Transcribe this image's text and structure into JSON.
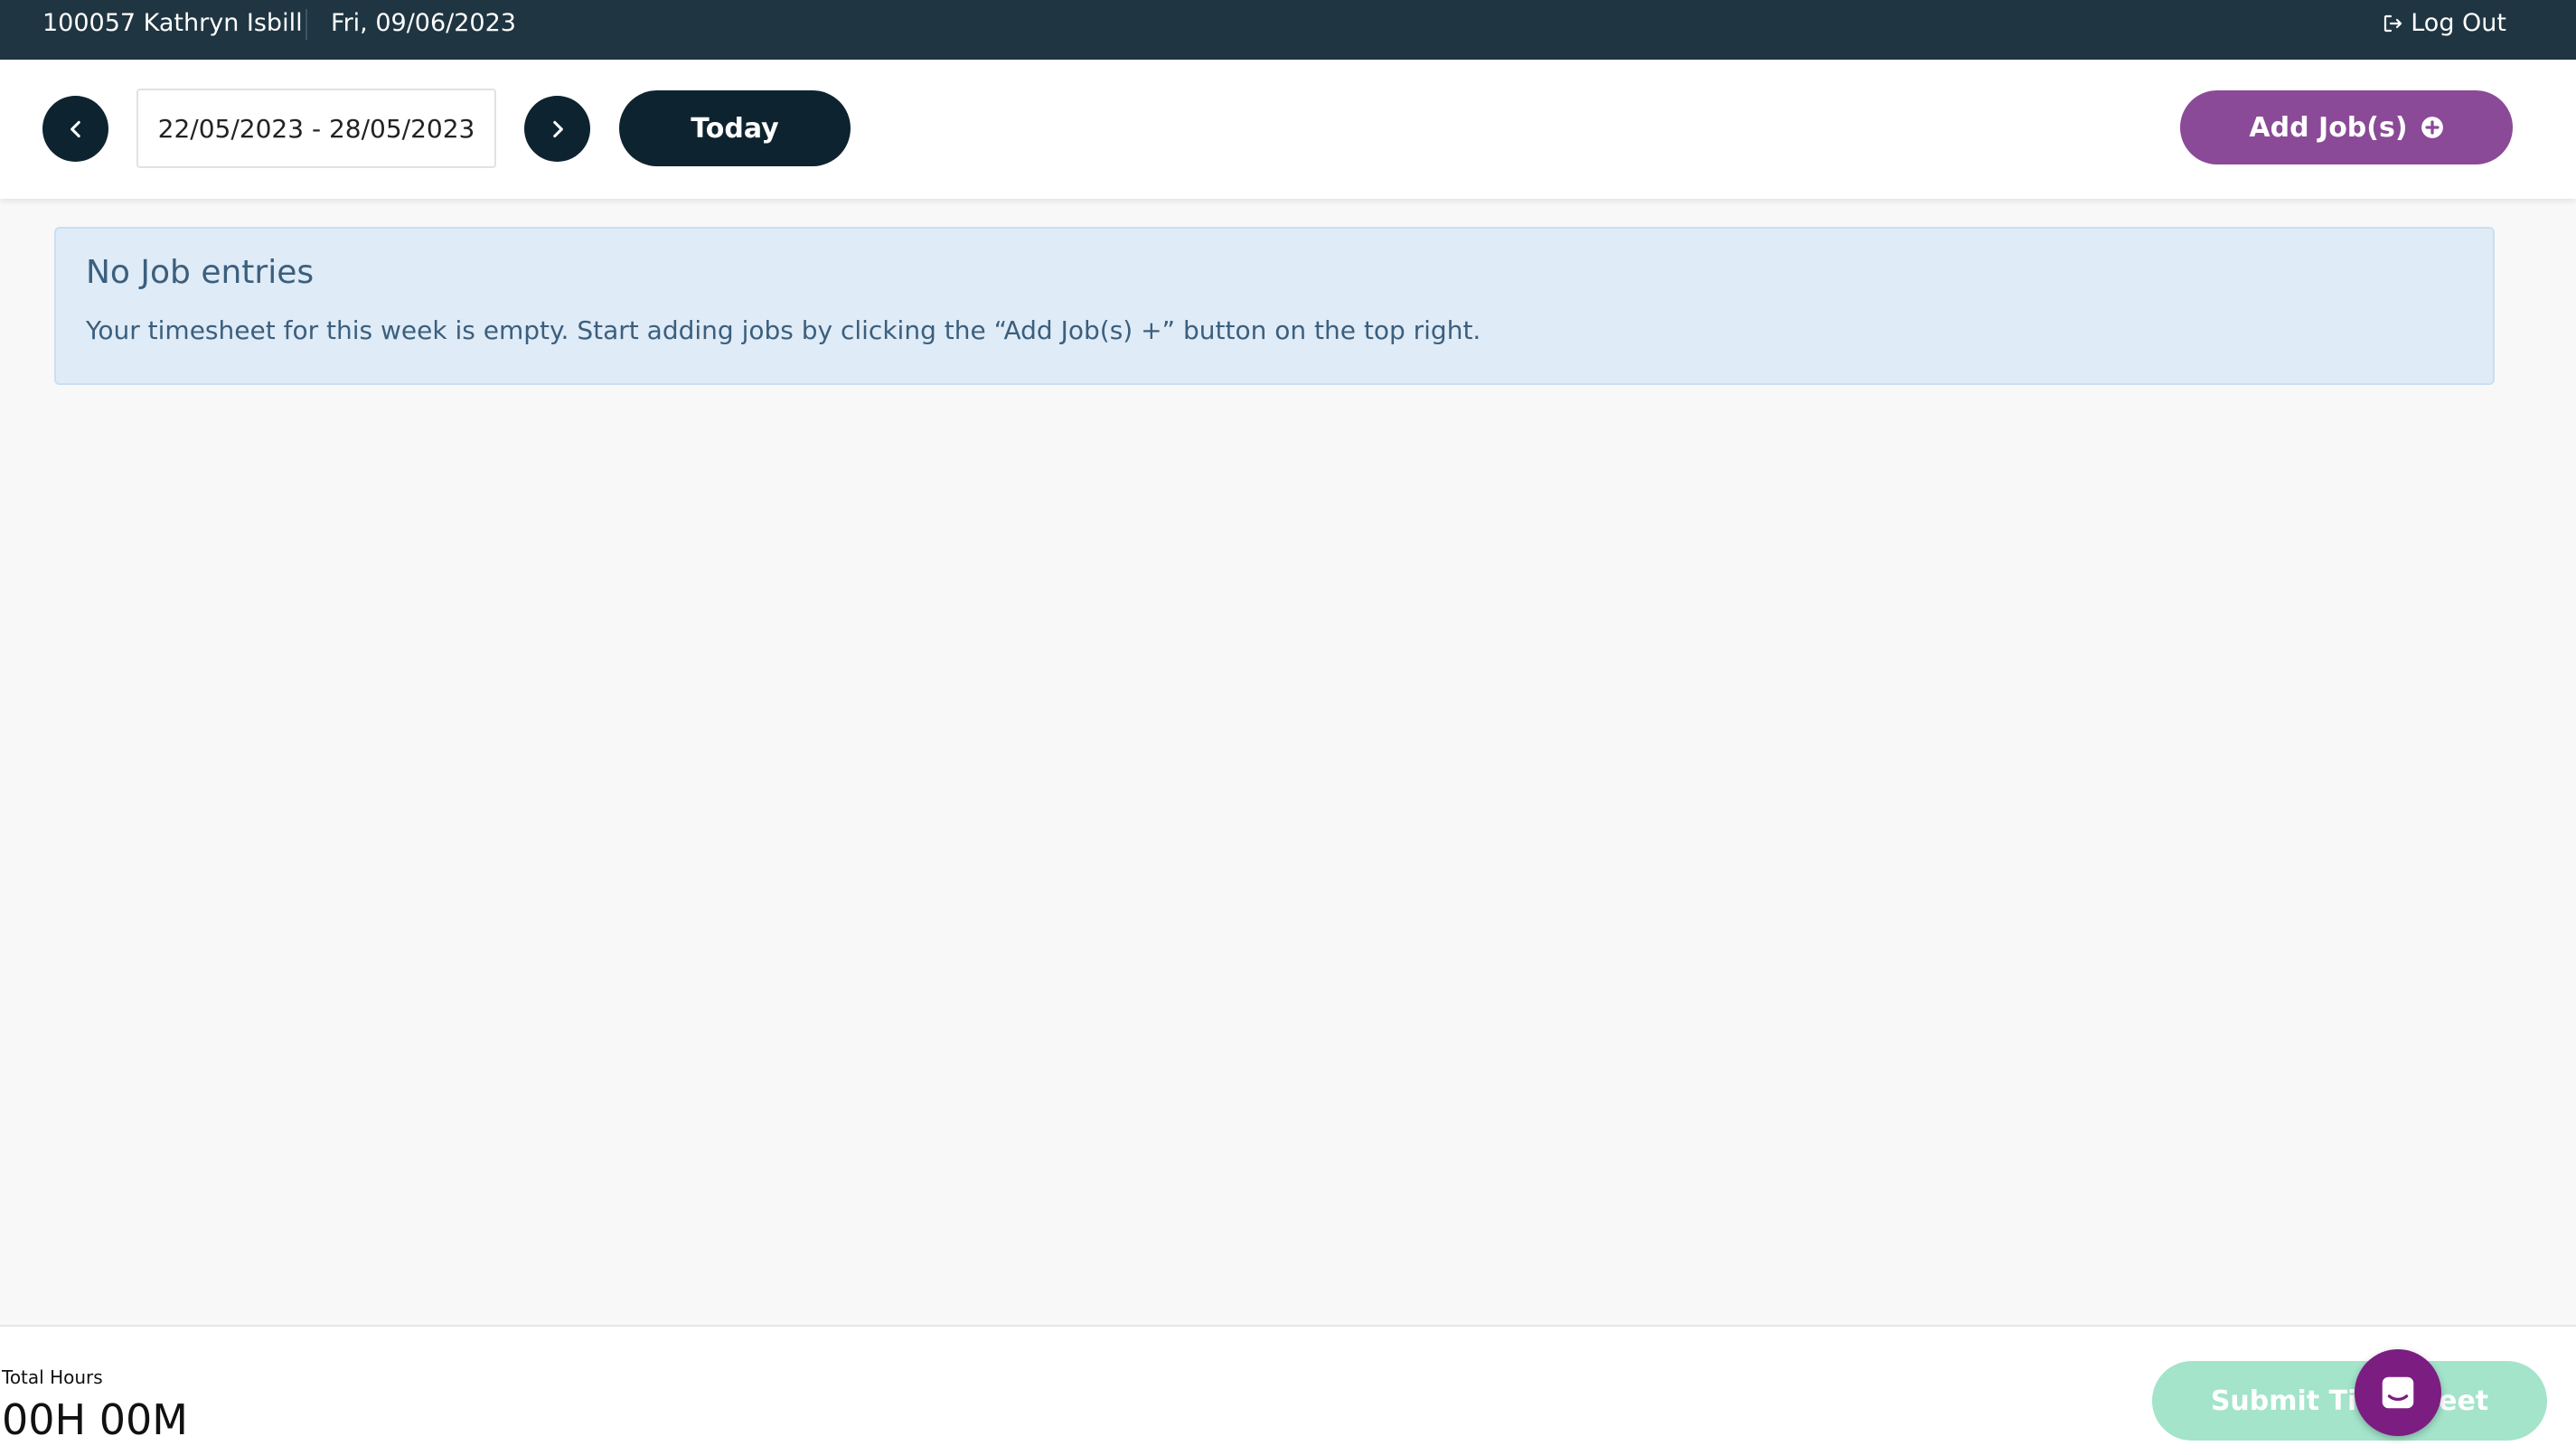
{
  "topbar": {
    "user": "100057 Kathryn Isbill",
    "date": "Fri, 09/06/2023",
    "logout_label": "Log Out",
    "logout_icon": "sign-out-icon"
  },
  "toolbar": {
    "prev_icon": "chevron-left-icon",
    "next_icon": "chevron-right-icon",
    "date_range": "22/05/2023 - 28/05/2023",
    "today_label": "Today",
    "add_jobs_label": "Add Job(s)",
    "add_jobs_icon": "plus-circle-icon"
  },
  "alert": {
    "title": "No Job entries",
    "text": "Your timesheet for this week is empty. Start adding jobs by clicking the “Add Job(s) +” button on the top right."
  },
  "footer": {
    "total_label": "Total Hours",
    "total_value": "00H 00M",
    "submit_label": "Submit Timesheet",
    "chat_icon": "chat-icon"
  },
  "colors": {
    "topbar_bg": "#1f3541",
    "primary_dark": "#0d2330",
    "accent_purple": "#8a4a97",
    "alert_bg": "#dfebf6",
    "submit_disabled": "#a3e4cb",
    "chat_bg": "#7c1d82"
  }
}
